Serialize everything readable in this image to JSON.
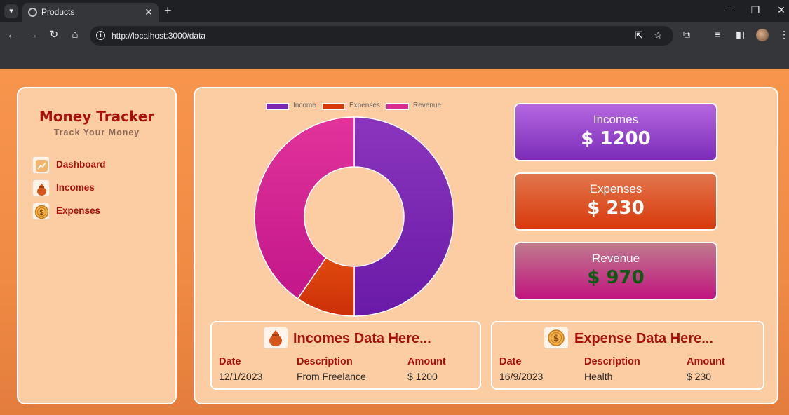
{
  "browser": {
    "tab_title": "Products",
    "url": "http://localhost:3000/data"
  },
  "sidebar": {
    "title": "Money Tracker",
    "subtitle": "Track Your Money",
    "items": [
      {
        "label": "Dashboard",
        "icon": "chart-icon"
      },
      {
        "label": "Incomes",
        "icon": "money-bag-icon"
      },
      {
        "label": "Expenses",
        "icon": "dollar-coin-icon"
      }
    ]
  },
  "chart_data": {
    "type": "pie",
    "subtype": "doughnut",
    "title": "",
    "legend_position": "top",
    "categories": [
      "Income",
      "Expenses",
      "Revenue"
    ],
    "values": [
      1200,
      230,
      970
    ],
    "colors": [
      "#7a26b0",
      "#d8390b",
      "#dc2b90"
    ]
  },
  "stats": {
    "incomes": {
      "label": "Incomes",
      "value": "$ 1200"
    },
    "expenses": {
      "label": "Expenses",
      "value": "$ 230"
    },
    "revenue": {
      "label": "Revenue",
      "value": "$ 970"
    }
  },
  "incomes_table": {
    "title": "Incomes Data Here...",
    "headers": [
      "Date",
      "Description",
      "Amount"
    ],
    "rows": [
      [
        "12/1/2023",
        "From Freelance",
        "$ 1200"
      ]
    ]
  },
  "expenses_table": {
    "title": "Expense Data Here...",
    "headers": [
      "Date",
      "Description",
      "Amount"
    ],
    "rows": [
      [
        "16/9/2023",
        "Health",
        "$ 230"
      ]
    ]
  },
  "colors": {
    "page_bg": "#f8954c",
    "panel_bg": "#fccda3",
    "brand_red": "#a8110a",
    "revenue_value": "#0d5a12"
  }
}
